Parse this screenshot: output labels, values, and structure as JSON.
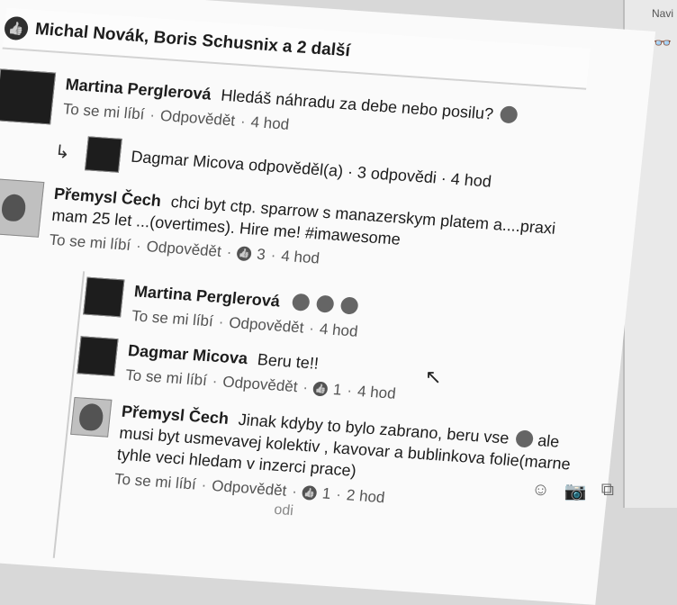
{
  "right_strip": {
    "nav_text": "Navi",
    "icon": "glasses-icon"
  },
  "likes_bar": {
    "text": "Michal Novák, Boris Schusnix a 2 další",
    "icon": "thumbs-up-icon"
  },
  "comments": [
    {
      "author": "Martina Perglerová",
      "text": "Hledáš náhradu za debe nebo posilu?",
      "like": "To se mi líbí",
      "reply": "Odpovědět",
      "time": "4 hod"
    },
    {
      "summary": "Dagmar Micova odpověděl(a) · 3 odpovědi · 4 hod"
    },
    {
      "author": "Přemysl Čech",
      "text": "chci byt ctp. sparrow s manazerskym platem a....praxi mam 25 let ...(overtimes). Hire me! #imawesome",
      "like": "To se mi líbí",
      "reply": "Odpovědět",
      "likes_count": "3",
      "time": "4 hod"
    },
    {
      "author": "Martina Perglerová",
      "text": "",
      "like": "To se mi líbí",
      "reply": "Odpovědět",
      "time": "4 hod"
    },
    {
      "author": "Dagmar Micova",
      "text": "Beru te!!",
      "like": "To se mi líbí",
      "reply": "Odpovědět",
      "likes_count": "1",
      "time": "4 hod"
    },
    {
      "author": "Přemysl Čech",
      "text": "Jinak kdyby to bylo zabrano, beru vse",
      "text2": "ale musi byt usmevavej kolektiv , kavovar a bublinkova folie(marne tyhle veci hledam v inzerci prace)",
      "like": "To se mi líbí",
      "reply": "Odpovědět",
      "likes_count": "1",
      "time": "2 hod"
    }
  ],
  "bottom_cutoff": "odi"
}
